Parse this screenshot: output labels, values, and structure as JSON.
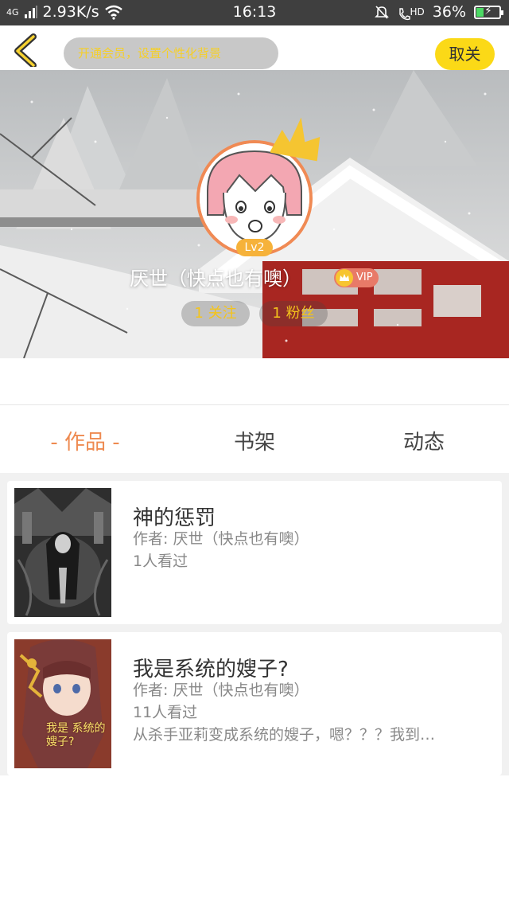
{
  "status_bar": {
    "network": "4G",
    "speed": "2.93K/s",
    "time": "16:13",
    "hd": "HD",
    "battery": "36%",
    "battery_level": 0.36
  },
  "header": {
    "promo_text": "开通会员，设置个性化背景",
    "close_label": "取关"
  },
  "profile": {
    "level": "Lv2",
    "username": "厌世（快点也有噢）",
    "vip_label": "VIP",
    "following": "1 关注",
    "fans": "1 粉丝"
  },
  "tabs": [
    {
      "label": "- 作品 -",
      "active": true
    },
    {
      "label": "书架",
      "active": false
    },
    {
      "label": "动态",
      "active": false
    }
  ],
  "books": [
    {
      "title": "神的惩罚",
      "author": "作者: 厌世（快点也有噢）",
      "views": "1人看过",
      "description": ""
    },
    {
      "title": "我是系统的嫂子?",
      "author": "作者: 厌世（快点也有噢）",
      "views": "11人看过",
      "description": "从杀手亚莉变成系统的嫂子，嗯？？？我到…",
      "cover_text": "我是 系统的 嫂子?"
    }
  ],
  "colors": {
    "accent": "#ee8a50",
    "yellow": "#fbd917",
    "status_bar": "#3f3f3f"
  }
}
